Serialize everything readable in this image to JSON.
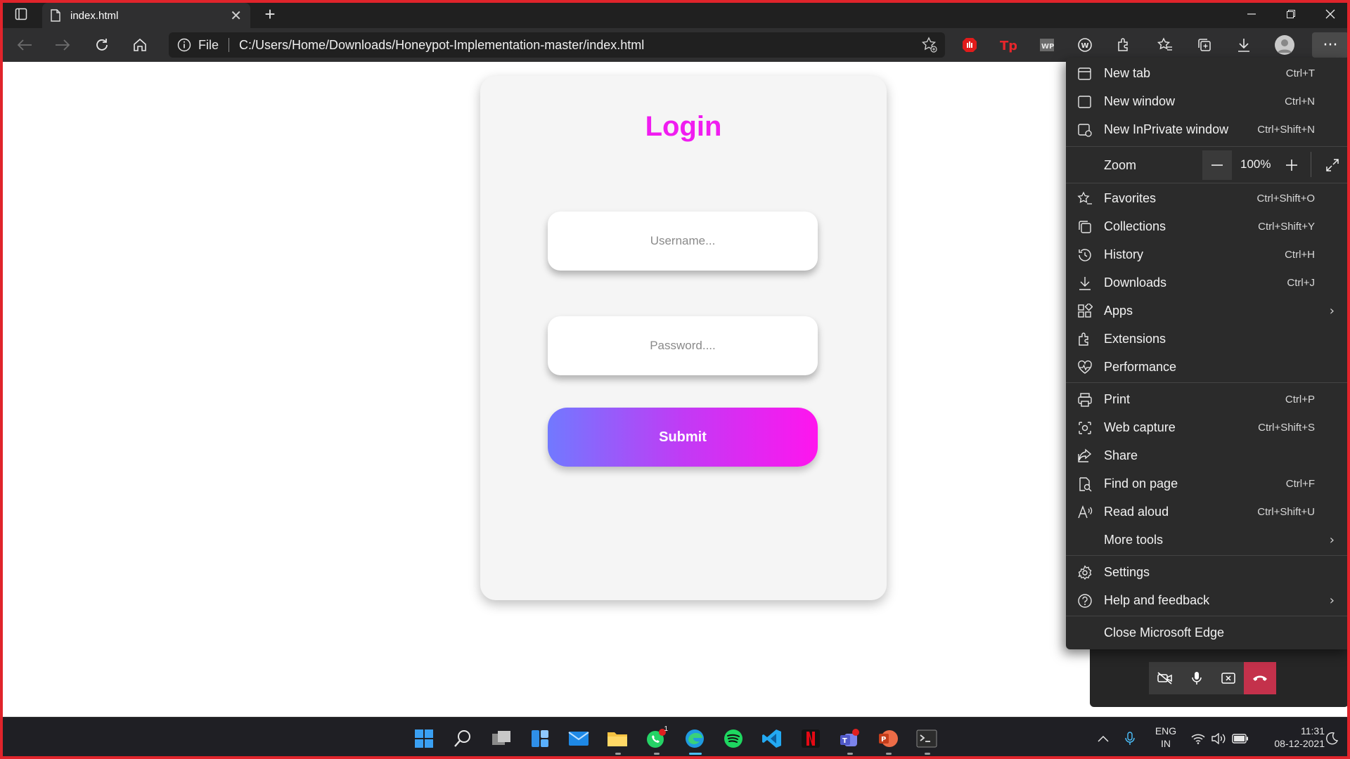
{
  "browser": {
    "tab_title": "index.html",
    "new_tab_symbol": "+",
    "file_label": "File",
    "url": "C:/Users/Home/Downloads/Honeypot-Implementation-master/index.html",
    "menu_button": "···"
  },
  "page": {
    "title": "Login",
    "username_placeholder": "Username...",
    "password_placeholder": "Password....",
    "submit_label": "Submit"
  },
  "menu": {
    "new_tab": {
      "label": "New tab",
      "shortcut": "Ctrl+T"
    },
    "new_window": {
      "label": "New window",
      "shortcut": "Ctrl+N"
    },
    "new_inprivate": {
      "label": "New InPrivate window",
      "shortcut": "Ctrl+Shift+N"
    },
    "zoom": {
      "label": "Zoom",
      "value": "100%"
    },
    "favorites": {
      "label": "Favorites",
      "shortcut": "Ctrl+Shift+O"
    },
    "collections": {
      "label": "Collections",
      "shortcut": "Ctrl+Shift+Y"
    },
    "history": {
      "label": "History",
      "shortcut": "Ctrl+H"
    },
    "downloads": {
      "label": "Downloads",
      "shortcut": "Ctrl+J"
    },
    "apps": {
      "label": "Apps"
    },
    "extensions": {
      "label": "Extensions"
    },
    "performance": {
      "label": "Performance"
    },
    "print": {
      "label": "Print",
      "shortcut": "Ctrl+P"
    },
    "web_capture": {
      "label": "Web capture",
      "shortcut": "Ctrl+Shift+S"
    },
    "share": {
      "label": "Share"
    },
    "find_on_page": {
      "label": "Find on page",
      "shortcut": "Ctrl+F"
    },
    "read_aloud": {
      "label": "Read aloud",
      "shortcut": "Ctrl+Shift+U"
    },
    "more_tools": {
      "label": "More tools"
    },
    "settings": {
      "label": "Settings"
    },
    "help_feedback": {
      "label": "Help and feedback"
    },
    "close_edge": {
      "label": "Close Microsoft Edge"
    }
  },
  "taskbar": {
    "language_line1": "ENG",
    "language_line2": "IN",
    "time": "11:31",
    "date": "08-12-2021",
    "whatsapp_badge": "1"
  },
  "colors": {
    "login_title": "#f01cf0",
    "submit_gradient_start": "#7179ff",
    "submit_gradient_end": "#ff15ee",
    "frame_border": "#e0242b",
    "hangup": "#c4314b"
  }
}
